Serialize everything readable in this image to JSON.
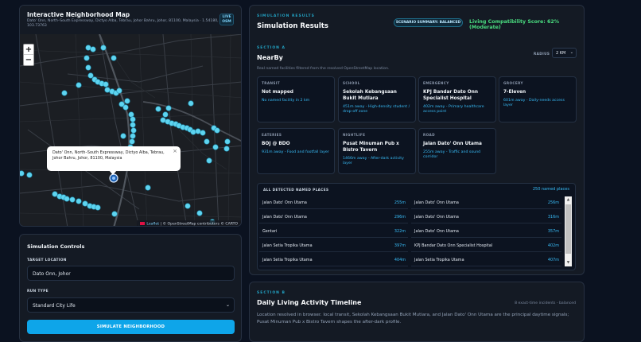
{
  "map": {
    "title": "Interactive Neighborhood Map",
    "address": "Dato' Onn, North–South Expressway, Dictyo Alba, Tebrau, Johor Bahru, Johor, 81100, Malaysia · 1.54180, 103.73763",
    "live_badge_top": "LIVE",
    "live_badge_bottom": "OSM",
    "zoom_in": "+",
    "zoom_out": "−",
    "popup_text": "Dato' Onn, North–South Expressway, Dictyo Alba, Tebrau, Johor Bahru, Johor, 81100, Malaysia",
    "popup_close": "×",
    "attribution_link": "Leaflet",
    "attribution_text": " | © OpenStreetMap contributors © CARTO"
  },
  "controls": {
    "title": "Simulation Controls",
    "target_label": "TARGET LOCATION",
    "target_value": "Dato Onn, Johor",
    "run_type_label": "RUN TYPE",
    "run_type_value": "Standard City Life",
    "simulate_button": "SIMULATE NEIGHBORHOOD"
  },
  "results": {
    "eyebrow": "SIMULATION RESULTS",
    "title": "Simulation Results",
    "scenario_badge": "SCENARIO SUMMARY: BALANCED",
    "score": "Living Compatibility Score: 62% (Moderate)",
    "section_eyebrow": "SECTION A",
    "section_title": "NearBy",
    "radius_label": "RADIUS",
    "radius_value": "2 KM",
    "section_desc": "Real named facilities filtered from the resolved OpenStreetMap location.",
    "cards": [
      {
        "category": "TRANSIT",
        "name": "Not mapped",
        "meta": "No named facility in 2 km"
      },
      {
        "category": "SCHOOL",
        "name": "Sekolah Kebangsaan Bukit Mutiara",
        "meta": "451m away - High-density student / drop-off zone"
      },
      {
        "category": "EMERGENCY",
        "name": "KPJ Bandar Dato Onn Specialist Hospital",
        "meta": "402m away - Primary healthcare access point"
      },
      {
        "category": "GROCERY",
        "name": "7-Eleven",
        "meta": "601m away - Daily-needs access layer"
      },
      {
        "category": "EATERIES",
        "name": "BOJ @ BDO",
        "meta": "931m away - Food and footfall layer"
      },
      {
        "category": "NIGHTLIFE",
        "name": "Pusat Minuman Pub x Bistro Tavern",
        "meta": "1466m away - After-dark activity layer"
      },
      {
        "category": "ROAD",
        "name": "Jalan Dato' Onn Utama",
        "meta": "255m away - Traffic and sound corridor"
      }
    ],
    "places_header": "ALL DETECTED NAMED PLACES",
    "places_count": "250 named places",
    "places": [
      {
        "name": "Jalan Dato' Onn Utama",
        "dist": "255m"
      },
      {
        "name": "Jalan Dato' Onn Utama",
        "dist": "256m"
      },
      {
        "name": "Jalan Dato' Onn Utama",
        "dist": "296m"
      },
      {
        "name": "Jalan Dato' Onn Utama",
        "dist": "316m"
      },
      {
        "name": "Gentari",
        "dist": "322m"
      },
      {
        "name": "Jalan Dato' Onn Utama",
        "dist": "357m"
      },
      {
        "name": "Jalan Setia Tropika Utama",
        "dist": "397m"
      },
      {
        "name": "KPJ Bandar Dato Onn Specialist Hospital",
        "dist": "402m"
      },
      {
        "name": "Jalan Setia Tropika Utama",
        "dist": "404m"
      },
      {
        "name": "Jalan Setia Tropika Utama",
        "dist": "407m"
      }
    ],
    "scroll_up": "▲",
    "scroll_down": "▼"
  },
  "daily": {
    "eyebrow": "SECTION B",
    "title": "Daily Living Activity Timeline",
    "meta": "8 exact-time incidents - balanced",
    "desc": "Location resolved in browser. local transit, Sekolah Kebangsaan Bukit Mutiara, and Jalan Dato' Onn Utama are the principal daytime signals; Pusat Minuman Pub x Bistro Tavern shapes the after-dark profile."
  },
  "colors": {
    "accent": "#0ea5e9",
    "score_green": "#4ade80",
    "poi_marker": "#5ed4f0",
    "background": "#0b1220",
    "panel": "#141a24"
  },
  "icons": [
    "close-icon",
    "chevron-down-icon",
    "location-marker-icon",
    "leaflet-logo-icon"
  ]
}
